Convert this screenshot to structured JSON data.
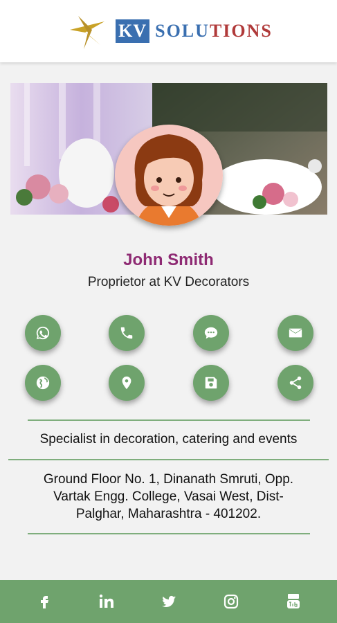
{
  "brand": {
    "kv": "KV",
    "solutions_part1": "SOLU",
    "solutions_part2": "TIONS"
  },
  "profile": {
    "name": "John Smith",
    "role": "Proprietor at KV Decorators",
    "tagline": "Specialist in decoration, catering and events",
    "address_lines": [
      "Ground Floor No. 1, Dinanath Smruti, Opp.",
      "Vartak Engg. College, Vasai West, Dist-",
      "Palghar, Maharashtra - 401202."
    ]
  },
  "actions": [
    {
      "id": "whatsapp",
      "icon": "whatsapp-icon"
    },
    {
      "id": "phone",
      "icon": "phone-icon"
    },
    {
      "id": "sms",
      "icon": "chat-icon"
    },
    {
      "id": "email",
      "icon": "envelope-icon"
    },
    {
      "id": "website",
      "icon": "globe-icon"
    },
    {
      "id": "location",
      "icon": "map-pin-icon"
    },
    {
      "id": "save-contact",
      "icon": "floppy-disk-icon"
    },
    {
      "id": "share",
      "icon": "share-icon"
    }
  ],
  "social": [
    {
      "id": "facebook",
      "icon": "facebook-icon"
    },
    {
      "id": "linkedin",
      "icon": "linkedin-icon"
    },
    {
      "id": "twitter",
      "icon": "twitter-icon"
    },
    {
      "id": "instagram",
      "icon": "instagram-icon"
    },
    {
      "id": "youtube",
      "icon": "youtube-icon"
    }
  ],
  "colors": {
    "accent": "#6fa36d",
    "name": "#8e2a73",
    "brand_blue": "#3a6fb0",
    "brand_red": "#b03a3a"
  }
}
